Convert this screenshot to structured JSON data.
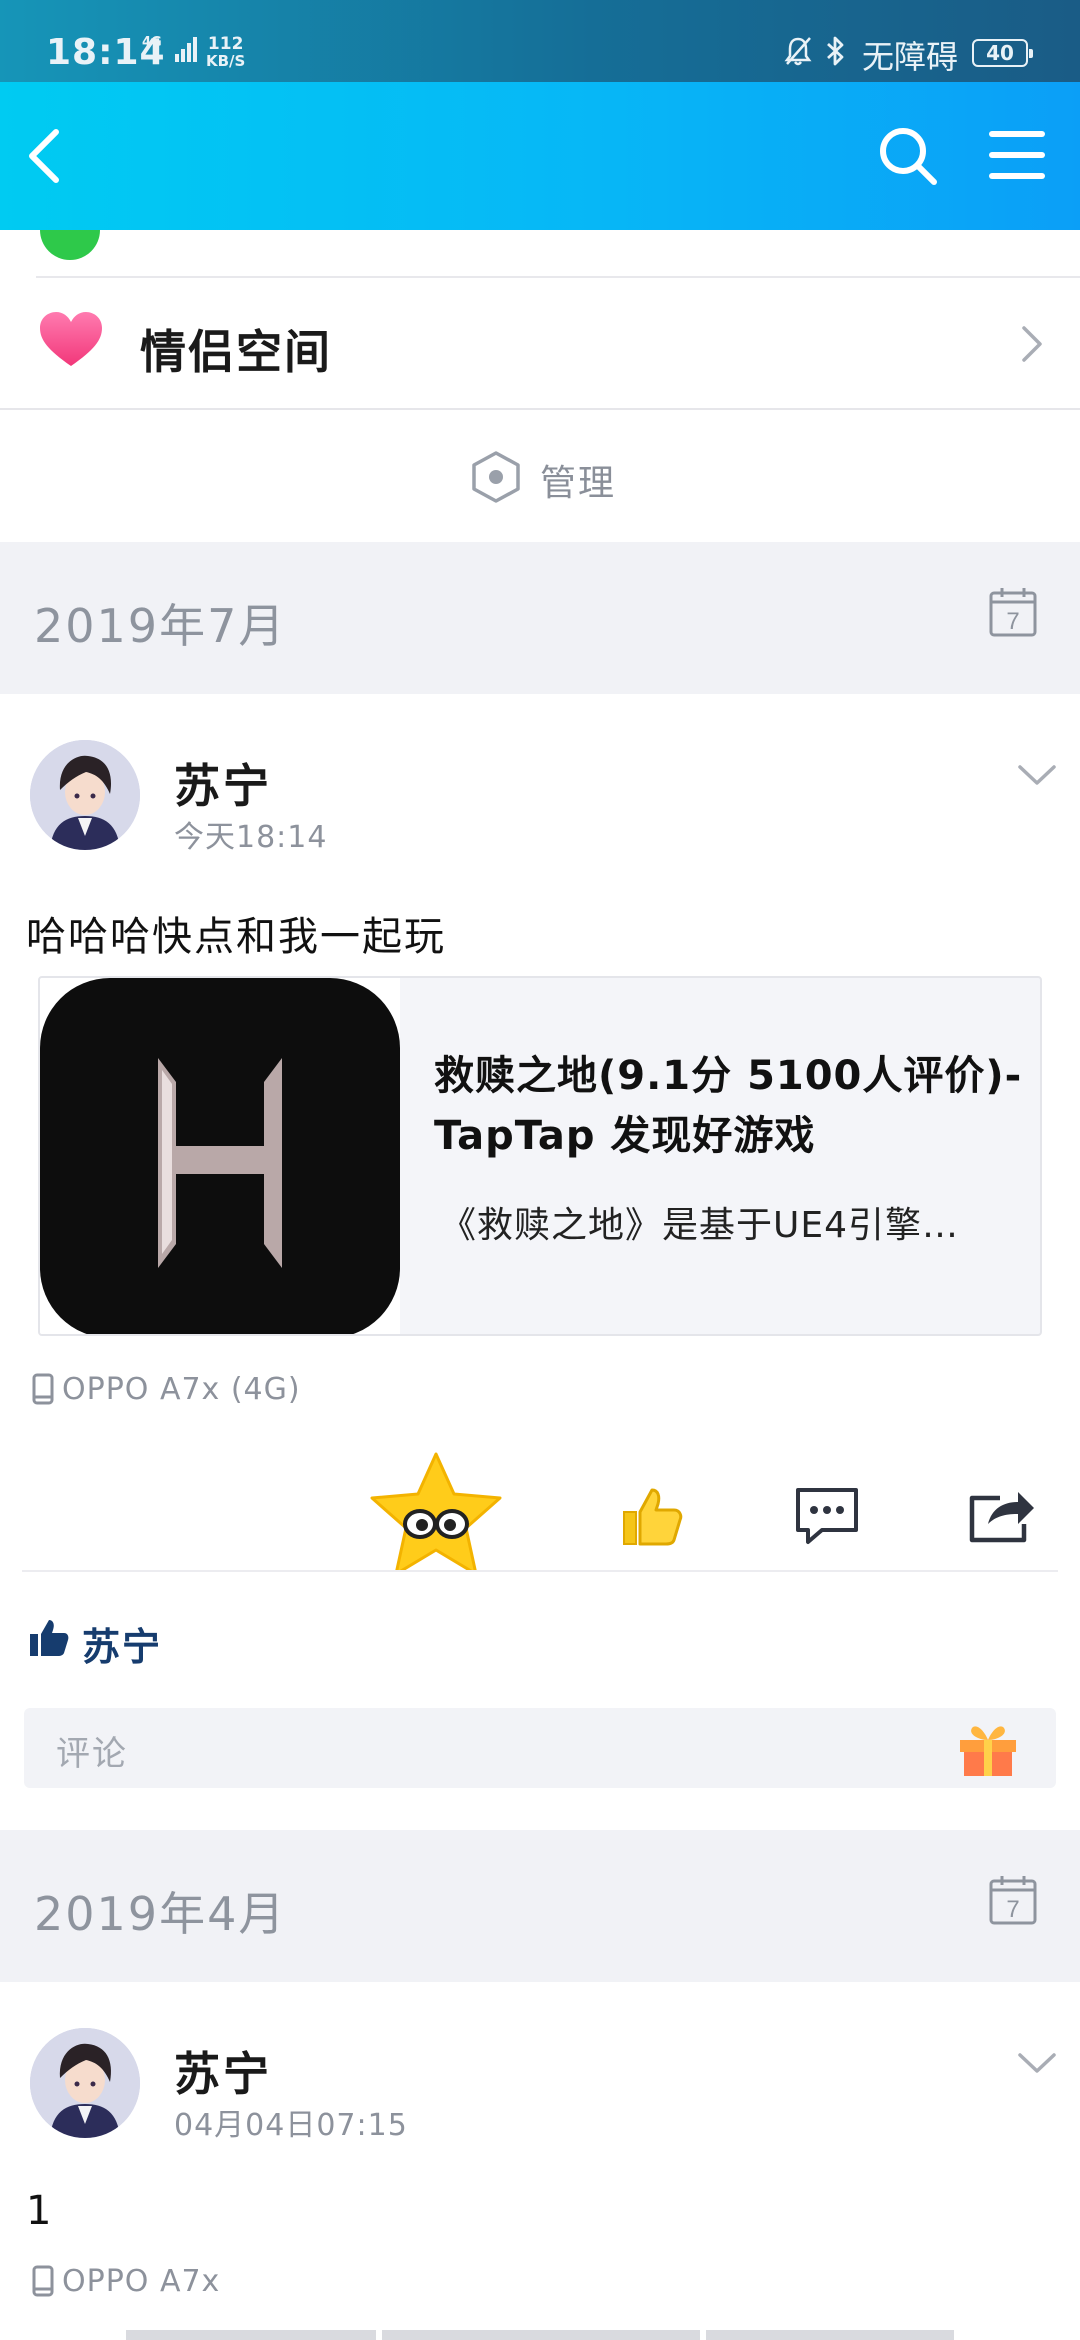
{
  "status_bar": {
    "time": "18:14",
    "network": "4G",
    "speed_value": "112",
    "speed_unit": "KB/S",
    "accessibility": "无障碍",
    "battery": "40"
  },
  "nav": {
    "back_icon": "back-arrow-icon",
    "search_icon": "search-icon",
    "menu_icon": "menu-icon"
  },
  "list": {
    "couple_space_label": "情侣空间",
    "manage_label": "管理"
  },
  "sections": [
    {
      "month": "2019年7月",
      "post": {
        "author": "苏宁",
        "time": "今天18:14",
        "text": "哈哈哈快点和我一起玩",
        "link_card": {
          "thumb_letter": "H",
          "title": "救赎之地(9.1分 5100人评价)- TapTap 发现好游戏",
          "description": "《救赎之地》是基于UE4引擎…"
        },
        "device": "OPPO A7x (4G)",
        "likes": [
          "苏宁"
        ],
        "comment_placeholder": "评论"
      }
    },
    {
      "month": "2019年4月",
      "post": {
        "author": "苏宁",
        "time": "04月04日07:15",
        "text": "1",
        "device": "OPPO A7x"
      }
    }
  ],
  "colors": {
    "nav_gradient_start": "#00cbf2",
    "nav_gradient_end": "#0b9ff7",
    "like_yellow": "#f5c518",
    "likes_name": "#163c6e",
    "heart_pink": "#f7568f"
  }
}
